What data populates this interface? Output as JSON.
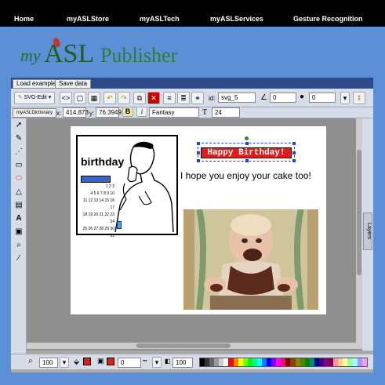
{
  "nav": {
    "items": [
      "Home",
      "myASLStore",
      "myASLTech",
      "myASLServices",
      "Gesture Recognition"
    ]
  },
  "logo": {
    "my": "my",
    "asl": "ASL",
    "publisher": "Publisher"
  },
  "menu": {
    "load_example": "Load example",
    "save_data": "Save data"
  },
  "toolbar": {
    "svg_edit": "SVG-Edit",
    "id_label": "id:",
    "id_value": "svg_5",
    "angle_value": "0",
    "blur_value": "0",
    "font_family": "Fantasy",
    "font_size": "24",
    "bold": "B",
    "italic": "i",
    "x_label": "x:",
    "x_value": "414.873",
    "y_label": "y:",
    "y_value": "76.3949",
    "dictionary_label": "myASLDictionary"
  },
  "canvas": {
    "sign_word": "birthday",
    "banner_text": "Happy Birthday!",
    "message": "I hope you enjoy your cake too!",
    "calendar_rows": [
      "1 2 3",
      "4 5 6 7 8 9 10",
      "11 12 13 14 15 16 17",
      "18 19 20 21 22 23 24",
      "25 26 27 28 29 30 31"
    ]
  },
  "layers_label": "Layers",
  "bottom": {
    "zoom_value": "100",
    "stroke_width": "0",
    "opacity_value": "100"
  },
  "colors": {
    "page_bg": "#5b8fd6",
    "banner_red": "#e41b1b",
    "logo_green": "#2e7d32",
    "menubar": "#2f4a88"
  }
}
